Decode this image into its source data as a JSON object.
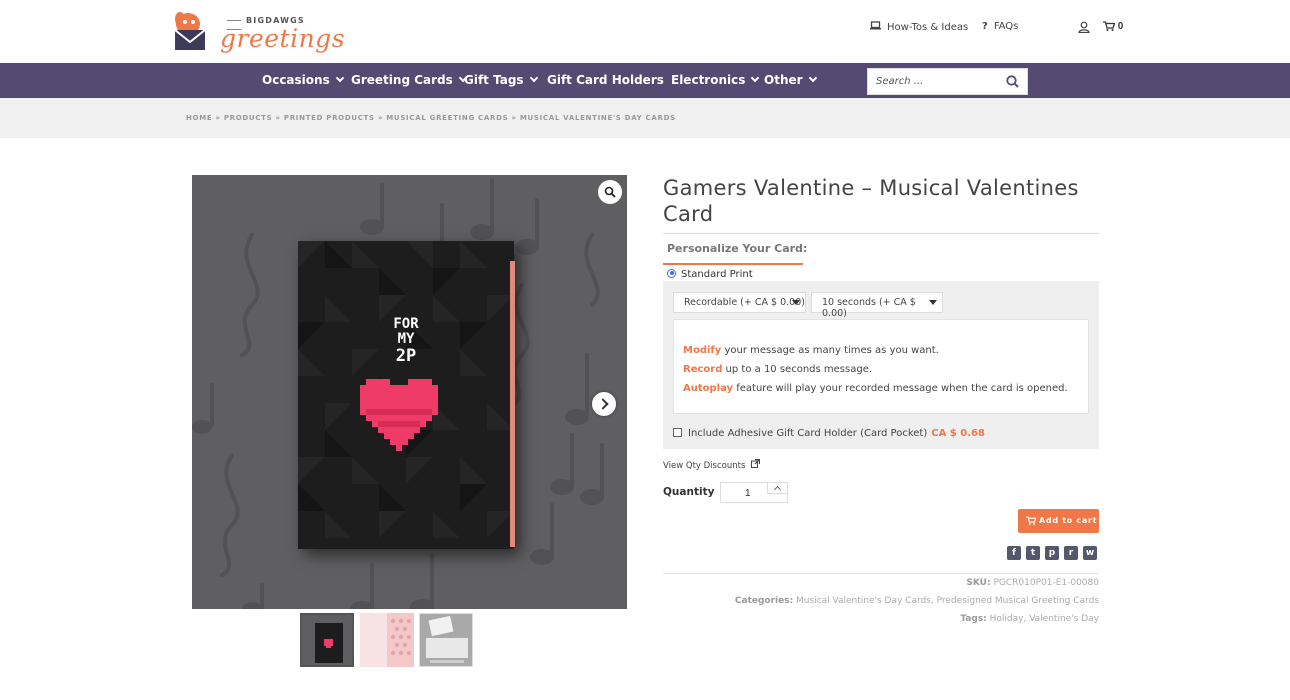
{
  "brand": {
    "top": "BIGDAWGS",
    "script": "greetings"
  },
  "header": {
    "howto_label": "How-Tos & Ideas",
    "faqs_label": "FAQs",
    "cart_count": "0"
  },
  "nav": {
    "items": [
      {
        "label": "Occasions",
        "has_dropdown": true
      },
      {
        "label": "Greeting Cards",
        "has_dropdown": true
      },
      {
        "label": "Gift Tags",
        "has_dropdown": true
      },
      {
        "label": "Gift Card Holders",
        "has_dropdown": false
      },
      {
        "label": "Electronics",
        "has_dropdown": true
      },
      {
        "label": "Other",
        "has_dropdown": true
      }
    ],
    "search_placeholder": "Search ..."
  },
  "breadcrumb": "HOME » PRODUCTS » PRINTED PRODUCTS » MUSICAL GREETING CARDS » MUSICAL VALENTINE'S DAY CARDS",
  "gallery": {
    "card_text": [
      "FOR",
      "MY",
      "2P"
    ]
  },
  "product": {
    "title": "Gamers Valentine – Musical Valentines Card",
    "personalize_label": "Personalize Your Card:",
    "print_option": "Standard Print",
    "select_recordable": "Recordable (+ CA $ 0.00)",
    "select_duration": "10 seconds (+ CA $ 0.00)",
    "info": [
      {
        "bold": "Modify",
        "rest": " your message as many times as you want."
      },
      {
        "bold": "Record",
        "rest": " up to a 10 seconds message."
      },
      {
        "bold": "Autoplay",
        "rest": " feature will play your recorded message when the card is opened."
      }
    ],
    "holder_label": "Include Adhesive Gift Card Holder (Card Pocket)",
    "holder_price": "CA $ 0.68",
    "qty_discounts": "View Qty Discounts",
    "quantity_label": "Quantity",
    "quantity_value": "1",
    "add_to_cart": "Add to cart",
    "sku_label": "SKU:",
    "sku_value": "PGCR010P01-E1-00080",
    "categories_label": "Categories:",
    "categories_value": "Musical Valentine's Day Cards, Predesigned Musical Greeting Cards",
    "tags_label": "Tags:",
    "tags_value": "Holiday, Valentine's Day"
  },
  "colors": {
    "accent": "#ef7748",
    "nav_bg": "#554a72",
    "heart": "#ee3b68"
  }
}
